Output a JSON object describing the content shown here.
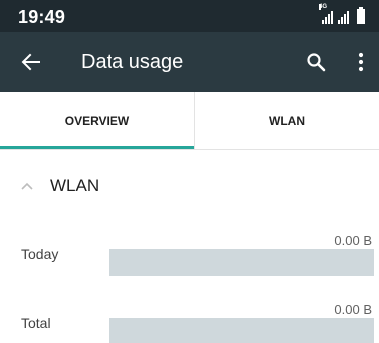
{
  "status_bar": {
    "time": "19:49",
    "network_type": "4G"
  },
  "app_bar": {
    "title": "Data usage"
  },
  "tabs": [
    {
      "label": "OVERVIEW",
      "selected": true
    },
    {
      "label": "WLAN",
      "selected": false
    }
  ],
  "section": {
    "title": "WLAN",
    "expanded": true
  },
  "usage": {
    "today": {
      "label": "Today",
      "value": "0.00 B",
      "fill_fraction": 0
    },
    "total": {
      "label": "Total",
      "value": "0.00 B",
      "fill_fraction": 0
    }
  },
  "colors": {
    "status_bar": "#1f2a30",
    "app_bar": "#2b3a41",
    "accent": "#26a69a",
    "bar_track": "#cfd8dc"
  },
  "icons": {
    "back": "arrow-left",
    "search": "magnifier",
    "more": "vertical-dots",
    "section_toggle": "chevron-up"
  }
}
